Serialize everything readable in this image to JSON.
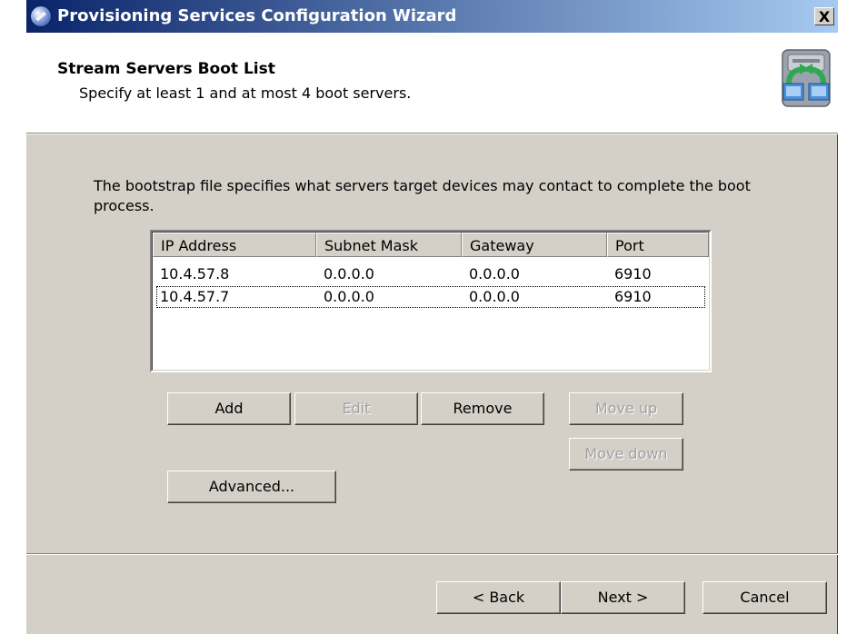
{
  "window": {
    "title": "Provisioning Services Configuration Wizard",
    "close_label": "X"
  },
  "header": {
    "title": "Stream Servers Boot List",
    "subtitle": "Specify at least 1 and at most 4 boot servers.",
    "art_icon": "network-servers-icon"
  },
  "intro_text": "The bootstrap file specifies what servers target devices may contact to complete the boot process.",
  "list": {
    "columns": [
      "IP Address",
      "Subnet Mask",
      "Gateway",
      "Port"
    ],
    "rows": [
      {
        "ip": "10.4.57.8",
        "subnet": "0.0.0.0",
        "gateway": "0.0.0.0",
        "port": "6910"
      },
      {
        "ip": "10.4.57.7",
        "subnet": "0.0.0.0",
        "gateway": "0.0.0.0",
        "port": "6910"
      }
    ]
  },
  "buttons": {
    "add": "Add",
    "edit": "Edit",
    "remove": "Remove",
    "move_up": "Move up",
    "move_down": "Move down",
    "advanced": "Advanced..."
  },
  "nav": {
    "back": "< Back",
    "next": "Next >",
    "cancel": "Cancel"
  },
  "colors": {
    "title_gradient_start": "#0a246a",
    "title_gradient_end": "#a6caf0",
    "face": "#d4d0c8"
  }
}
